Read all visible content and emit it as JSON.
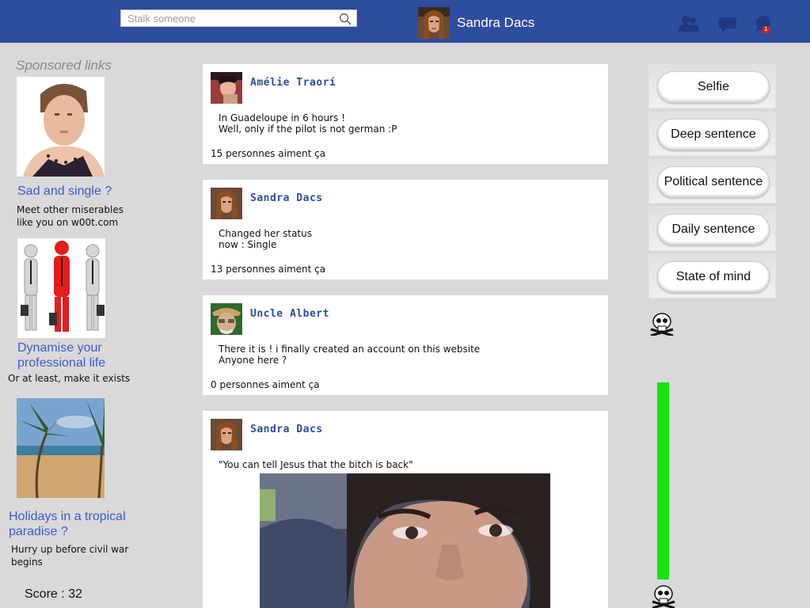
{
  "header": {
    "search_placeholder": "Stalk someone",
    "user_name": "Sandra Dacs",
    "notification_count": "1",
    "icons": [
      "friends-icon",
      "messages-icon",
      "notifications-icon"
    ],
    "brand_color": "#2d4d9e"
  },
  "sponsored": {
    "title": "Sponsored links",
    "ads": [
      {
        "title": "Sad and single ?",
        "text": "Meet other miserables\nlike you on w00t.com"
      },
      {
        "title": "Dynamise your professional life",
        "text": "Or at least, make it exists"
      },
      {
        "title": "Holidays in a tropical paradise ?",
        "text": "Hurry up before civil war\nbegins"
      }
    ]
  },
  "score": {
    "label": "Score : 32"
  },
  "feed": {
    "posts": [
      {
        "author": "Amélie Traorí",
        "text": "In Guadeloupe in 6 hours !\nWell, only if the pilot is not german :P",
        "likes": "15 personnes aiment ça"
      },
      {
        "author": "Sandra Dacs",
        "text": "Changed her status\nnow : Single",
        "likes": "13 personnes aiment ça"
      },
      {
        "author": "Uncle Albert",
        "text": "There it is ! i finally created an account on this website\nAnyone here ?",
        "likes": "0 personnes aiment ça"
      },
      {
        "author": "Sandra Dacs",
        "text": "\"You can tell Jesus that the bitch is back\""
      }
    ]
  },
  "actions": {
    "buttons": [
      "Selfie",
      "Deep sentence",
      "Political sentence",
      "Daily sentence",
      "State of mind"
    ]
  },
  "meter": {
    "level": 0.995,
    "color": "#14e414"
  }
}
